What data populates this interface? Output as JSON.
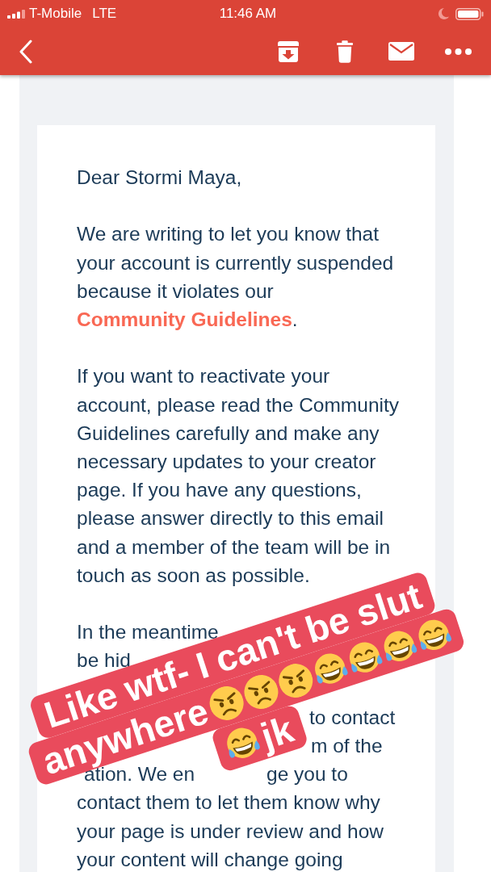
{
  "status_bar": {
    "carrier": "T-Mobile",
    "network": "LTE",
    "time": "11:46 AM"
  },
  "email": {
    "paragraphs": [
      {
        "kind": "plain",
        "text": "Dear Stormi Maya,"
      },
      {
        "kind": "with_link",
        "before": "We are writing to let you know that your account is currently suspended because it violates our",
        "link": "Community Guidelines",
        "after": "."
      },
      {
        "kind": "plain",
        "text": "If you want to reactivate your account, please read the Community Guidelines carefully and make any necessary updates to your creator page. If you have any questions, please answer directly to this email and a member of the team will be in touch as soon as possible."
      },
      {
        "kind": "covered",
        "lines": [
          {
            "start": "In the meantime"
          },
          {
            "start": "be hid"
          },
          {
            "end": "to contact"
          },
          {
            "end": "m of the"
          },
          {
            "start": "ation. We en",
            "end": "ge you to"
          }
        ],
        "rest": "contact them to let them know why your page is under review and how your content will change going"
      }
    ]
  },
  "sticker": {
    "lines": [
      {
        "parts": [
          {
            "kind": "text",
            "text": "Like wtf- I can't be slut"
          }
        ]
      },
      {
        "parts": [
          {
            "kind": "text",
            "text": "anywhere"
          },
          {
            "kind": "angry_face"
          },
          {
            "kind": "angry_face"
          },
          {
            "kind": "angry_face"
          },
          {
            "kind": "tears_of_joy_face"
          },
          {
            "kind": "tears_of_joy_face"
          },
          {
            "kind": "tears_of_joy_face"
          },
          {
            "kind": "tears_of_joy_face"
          }
        ]
      },
      {
        "parts": [
          {
            "kind": "tears_of_joy_face"
          },
          {
            "kind": "text",
            "text": "jk"
          }
        ]
      }
    ]
  }
}
